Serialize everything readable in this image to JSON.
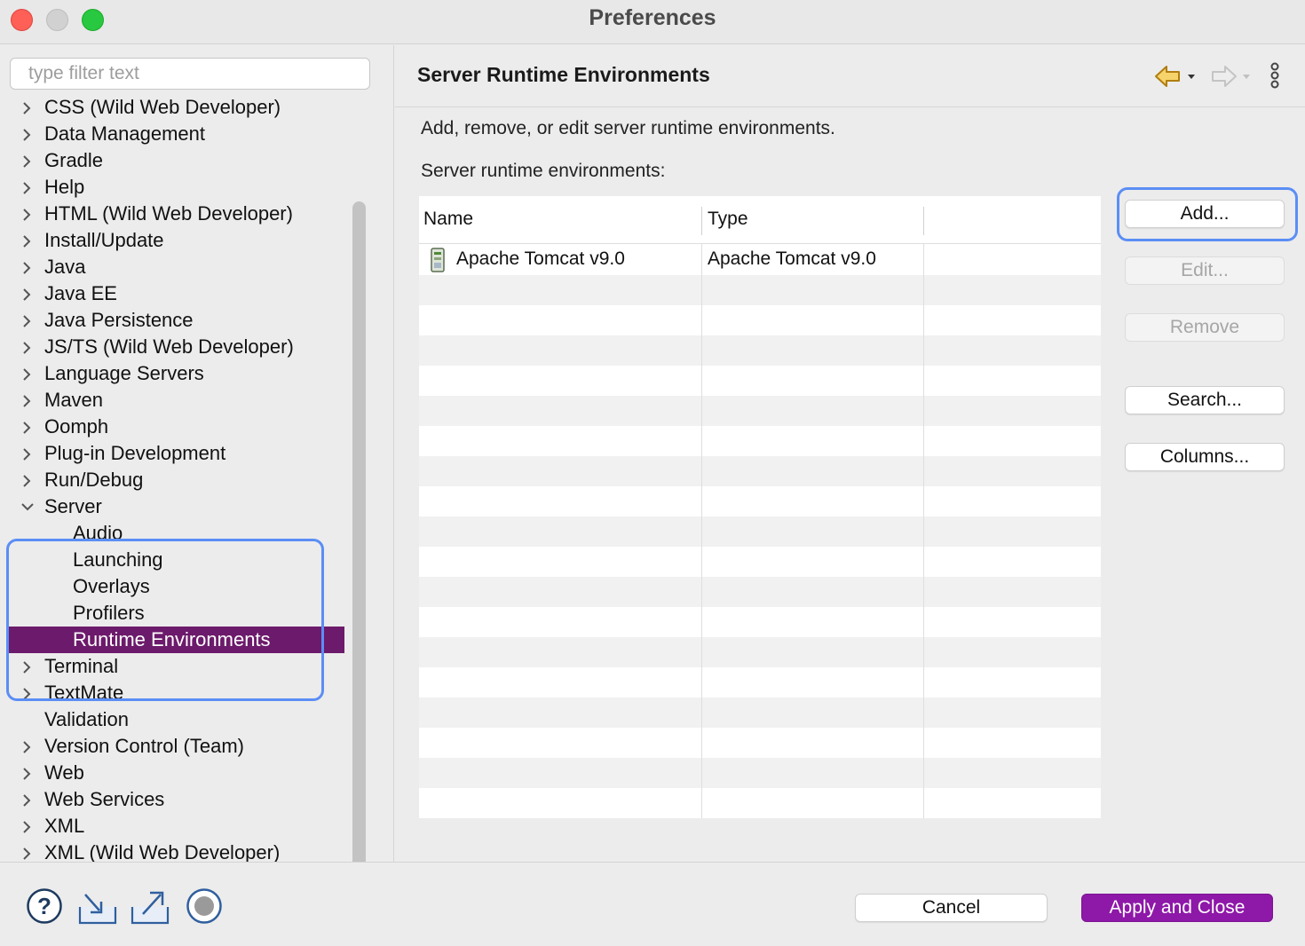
{
  "window": {
    "title": "Preferences"
  },
  "sidebar": {
    "filter_placeholder": "type filter text",
    "items": [
      {
        "label": "CSS (Wild Web Developer)",
        "expandable": true,
        "expanded": false
      },
      {
        "label": "Data Management",
        "expandable": true,
        "expanded": false
      },
      {
        "label": "Gradle",
        "expandable": true,
        "expanded": false
      },
      {
        "label": "Help",
        "expandable": true,
        "expanded": false
      },
      {
        "label": "HTML (Wild Web Developer)",
        "expandable": true,
        "expanded": false
      },
      {
        "label": "Install/Update",
        "expandable": true,
        "expanded": false
      },
      {
        "label": "Java",
        "expandable": true,
        "expanded": false
      },
      {
        "label": "Java EE",
        "expandable": true,
        "expanded": false
      },
      {
        "label": "Java Persistence",
        "expandable": true,
        "expanded": false
      },
      {
        "label": "JS/TS (Wild Web Developer)",
        "expandable": true,
        "expanded": false
      },
      {
        "label": "Language Servers",
        "expandable": true,
        "expanded": false
      },
      {
        "label": "Maven",
        "expandable": true,
        "expanded": false
      },
      {
        "label": "Oomph",
        "expandable": true,
        "expanded": false
      },
      {
        "label": "Plug-in Development",
        "expandable": true,
        "expanded": false
      },
      {
        "label": "Run/Debug",
        "expandable": true,
        "expanded": false
      },
      {
        "label": "Server",
        "expandable": true,
        "expanded": true
      },
      {
        "label": "Audio",
        "child": true
      },
      {
        "label": "Launching",
        "child": true
      },
      {
        "label": "Overlays",
        "child": true
      },
      {
        "label": "Profilers",
        "child": true
      },
      {
        "label": "Runtime Environments",
        "child": true,
        "selected": true
      },
      {
        "label": "Terminal",
        "expandable": true,
        "expanded": false
      },
      {
        "label": "TextMate",
        "expandable": true,
        "expanded": false
      },
      {
        "label": "Validation",
        "expandable": false
      },
      {
        "label": "Version Control (Team)",
        "expandable": true,
        "expanded": false
      },
      {
        "label": "Web",
        "expandable": true,
        "expanded": false
      },
      {
        "label": "Web Services",
        "expandable": true,
        "expanded": false
      },
      {
        "label": "XML",
        "expandable": true,
        "expanded": false
      },
      {
        "label": "XML (Wild Web Developer)",
        "expandable": true,
        "expanded": false
      }
    ]
  },
  "main": {
    "title": "Server Runtime Environments",
    "description": "Add, remove, or edit server runtime environments.",
    "list_label": "Server runtime environments:",
    "table": {
      "columns": [
        "Name",
        "Type"
      ],
      "rows": [
        {
          "name": "Apache Tomcat v9.0",
          "type": "Apache Tomcat v9.0",
          "icon": "server-icon"
        }
      ]
    },
    "buttons": {
      "add": "Add...",
      "edit": "Edit...",
      "remove": "Remove",
      "search": "Search...",
      "columns": "Columns..."
    }
  },
  "footer": {
    "cancel": "Cancel",
    "apply_close": "Apply and Close",
    "icons": [
      "help-icon",
      "import-icon",
      "export-icon",
      "oomph-record-icon"
    ]
  },
  "colors": {
    "selection": "#6c1a6b",
    "primary_button": "#8e18a8",
    "focus_ring": "#5b8ef5"
  }
}
